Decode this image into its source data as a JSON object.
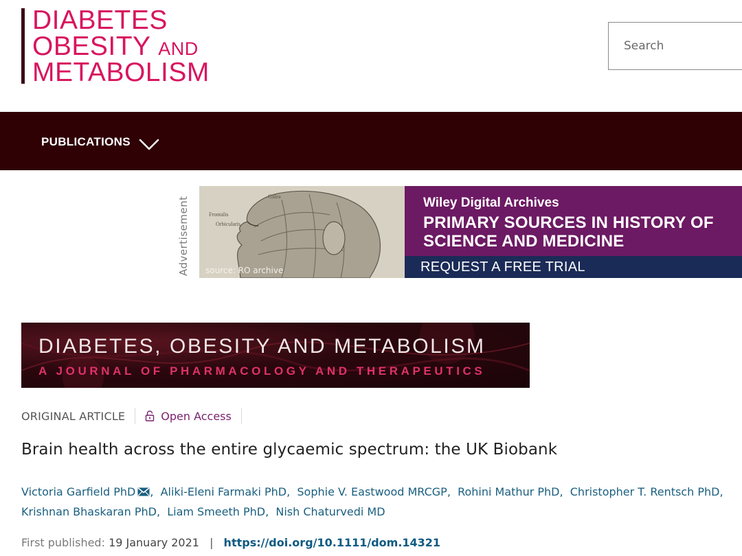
{
  "header": {
    "logo_line1": "DIABETES",
    "logo_line2_main": "OBESITY",
    "logo_line2_small": "AND",
    "logo_line3": "METABOLISM",
    "search_placeholder": "Search"
  },
  "nav": {
    "publications_label": "PUBLICATIONS"
  },
  "advertisement": {
    "label": "Advertisement",
    "source_caption": "source: RO archive",
    "brand": "Wiley Digital Archives",
    "headline": "PRIMARY SOURCES IN HISTORY OF SCIENCE AND MEDICINE",
    "cta": "REQUEST A FREE TRIAL"
  },
  "journal_banner": {
    "title": "DIABETES, OBESITY AND METABOLISM",
    "subtitle": "A JOURNAL OF PHARMACOLOGY AND THERAPEUTICS"
  },
  "article": {
    "type": "ORIGINAL ARTICLE",
    "access": "Open Access",
    "title": "Brain health across the entire glycaemic spectrum: the UK Biobank",
    "authors": [
      "Victoria Garfield PhD",
      "Aliki-Eleni Farmaki PhD",
      "Sophie V. Eastwood MRCGP",
      "Rohini Mathur PhD",
      "Christopher T. Rentsch PhD",
      "Krishnan Bhaskaran PhD",
      "Liam Smeeth PhD",
      "Nish Chaturvedi MD"
    ],
    "first_published_label": "First published:",
    "first_published_date": "19 January 2021",
    "separator": "|",
    "doi": "https://doi.org/10.1111/dom.14321"
  },
  "colors": {
    "brand_pink": "#d8155f",
    "navbar": "#2f0105",
    "ad_purple": "#6c1a63",
    "ad_navy": "#1b2b57",
    "link_blue": "#1a5f80",
    "open_access_purple": "#7a1f6e"
  }
}
